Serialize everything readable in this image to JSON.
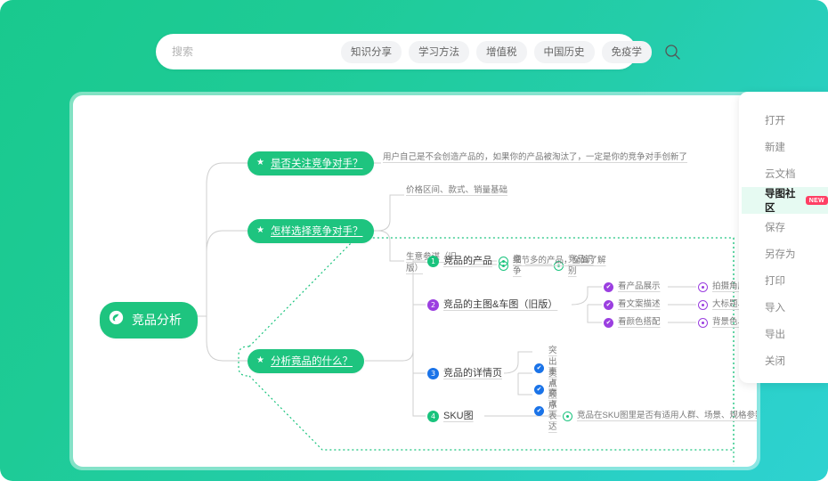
{
  "search": {
    "placeholder": "搜索",
    "value": "",
    "icon": "search-icon",
    "tags": [
      "知识分享",
      "学习方法",
      "增值税",
      "中国历史",
      "免疫学"
    ]
  },
  "side_menu": {
    "items": [
      {
        "label": "打开",
        "active": false,
        "badge": ""
      },
      {
        "label": "新建",
        "active": false,
        "badge": ""
      },
      {
        "label": "云文档",
        "active": false,
        "badge": ""
      },
      {
        "label": "导图社区",
        "active": true,
        "badge": "NEW"
      },
      {
        "label": "保存",
        "active": false,
        "badge": ""
      },
      {
        "label": "另存为",
        "active": false,
        "badge": ""
      },
      {
        "label": "打印",
        "active": false,
        "badge": ""
      },
      {
        "label": "导入",
        "active": false,
        "badge": ""
      },
      {
        "label": "导出",
        "active": false,
        "badge": ""
      },
      {
        "label": "关闭",
        "active": false,
        "badge": ""
      }
    ]
  },
  "mindmap": {
    "root": {
      "label": "竞品分析",
      "icon": "spiral-leaf-icon"
    },
    "branch1": {
      "label": "是否关注竞争对手？",
      "icon": "star-icon",
      "note": "用户自己是不会创造产品的，如果你的产品被淘汰了，一定是你的竞争对手创新了"
    },
    "branch2": {
      "label": "怎样选择竞争对手？",
      "icon": "star-icon",
      "child_a": "价格区间、款式、销量基础",
      "child_b": "生意参谋（旧版）",
      "child_c": "竞争",
      "child_d": "竞品识别"
    },
    "branch3": {
      "label": "分析竟品的什么？",
      "icon": "star-icon",
      "selected": true,
      "items": [
        {
          "num": "1",
          "color": "green",
          "label": "竞品的产品",
          "detail": "细节多的产品，全面了解",
          "children": []
        },
        {
          "num": "2",
          "color": "purple",
          "label": "竞品的主图&车图（旧版）",
          "detail": "",
          "children": [
            {
              "label": "看产品展示",
              "detail": "拍摄角度、是否精修、是"
            },
            {
              "label": "看文案描述",
              "detail": "大标题、小标题、标签字"
            },
            {
              "label": "看颜色搭配",
              "detail": "背景色、装饰物颜色、文"
            }
          ]
        },
        {
          "num": "3",
          "color": "blue",
          "label": "竞品的详情页",
          "detail": "",
          "children": [
            {
              "label": "突出卖点",
              "detail": ""
            },
            {
              "label": "卖点顺序",
              "detail": ""
            },
            {
              "label": "卖点表达",
              "detail": ""
            }
          ]
        },
        {
          "num": "4",
          "color": "green",
          "label": "SKU图",
          "detail": "竞品在SKU图里是否有适用人群、场景、规格参数的标注，我们",
          "children": []
        }
      ]
    }
  },
  "colors": {
    "background_start": "#19c98e",
    "background_end": "#2ed2d0",
    "node_green": "#1ec47f",
    "badge_purple": "#9b3fe0",
    "badge_blue": "#1a73e8",
    "new_badge": "#ff3f64",
    "selection_dotted": "#19c37d"
  }
}
